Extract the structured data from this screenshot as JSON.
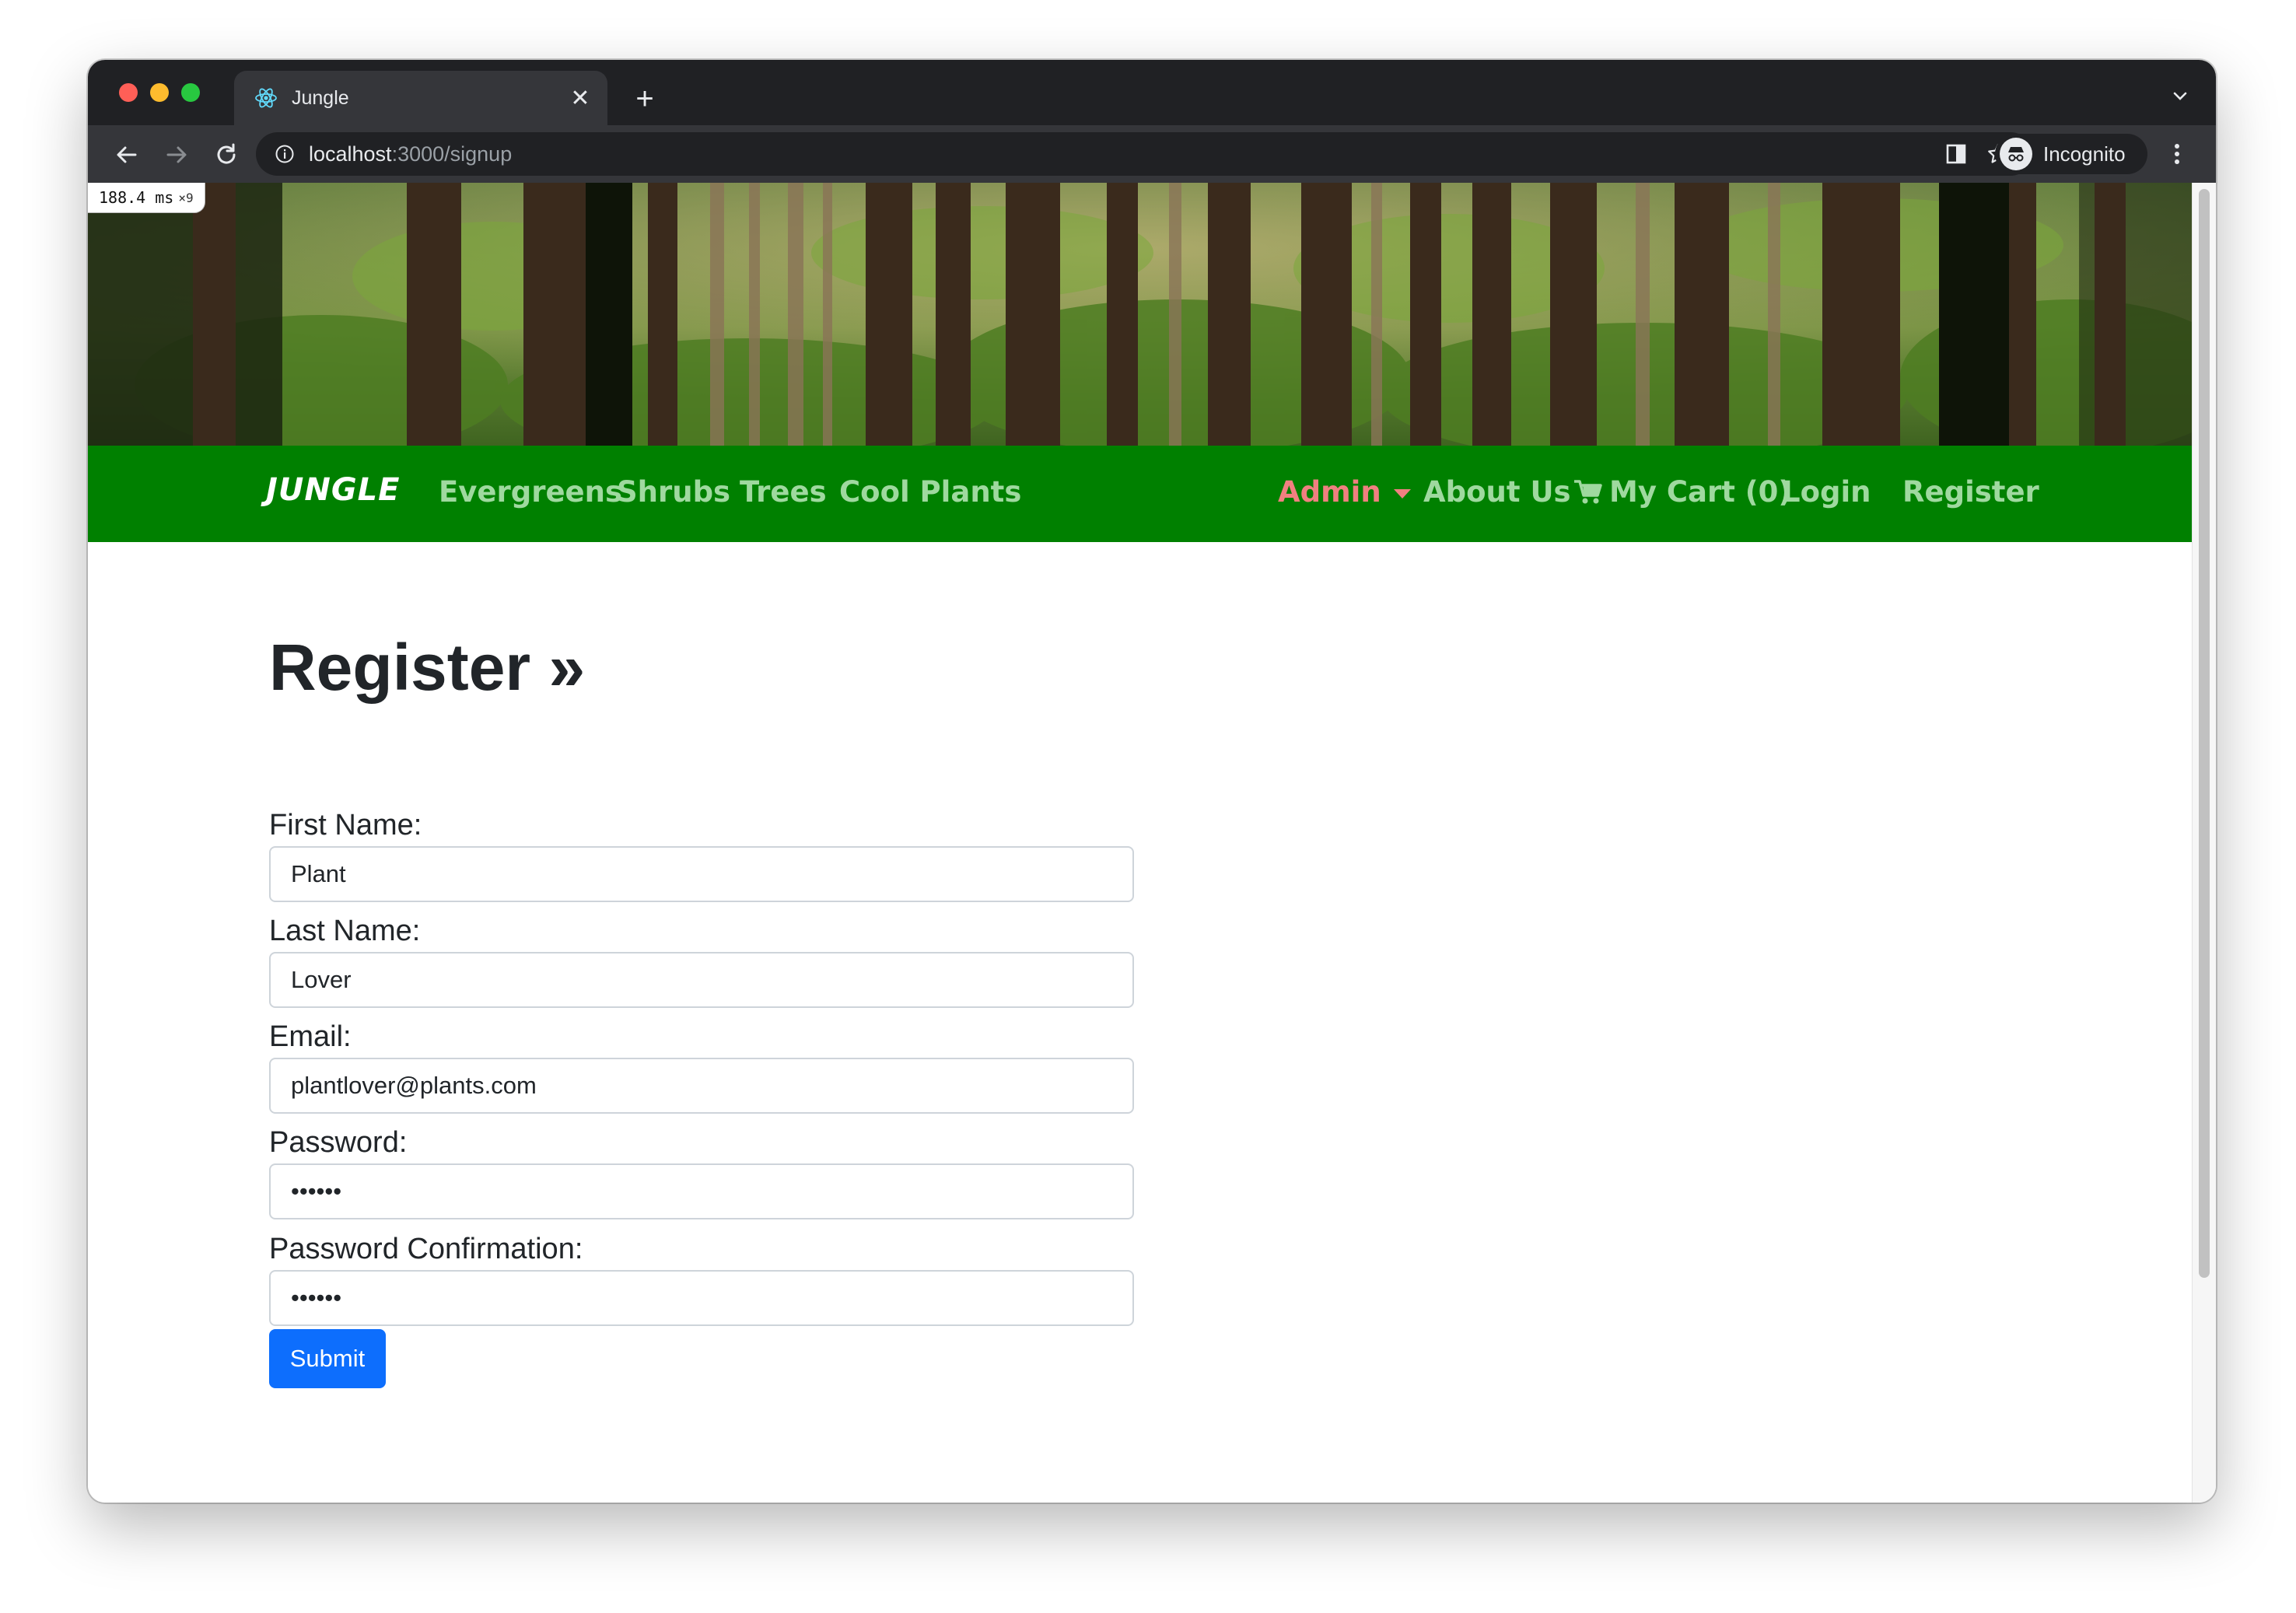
{
  "browser": {
    "tab_title": "Jungle",
    "url_host": "localhost",
    "url_rest": ":3000/signup",
    "profile_label": "Incognito"
  },
  "perf_overlay": {
    "time": "188.4 ms",
    "multiplier": "×9"
  },
  "navbar": {
    "brand": "JUNGLE",
    "left_links": [
      "Evergreens",
      "Shrubs",
      "Trees",
      "Cool Plants"
    ],
    "admin": "Admin",
    "about": "About Us",
    "cart": "My Cart (0)",
    "login": "Login",
    "register": "Register"
  },
  "form": {
    "title": "Register »",
    "first_name_label": "First Name:",
    "first_name_value": "Plant",
    "last_name_label": "Last Name:",
    "last_name_value": "Lover",
    "email_label": "Email:",
    "email_value": "plantlover@plants.com",
    "password_label": "Password:",
    "password_value": "••••••",
    "confirm_label": "Password Confirmation:",
    "confirm_value": "••••••",
    "submit_label": "Submit"
  },
  "colors": {
    "navbar_bg": "#008000",
    "nav_link": "#9fd99f",
    "admin_link": "#f08080",
    "submit_bg": "#0d6efd"
  }
}
